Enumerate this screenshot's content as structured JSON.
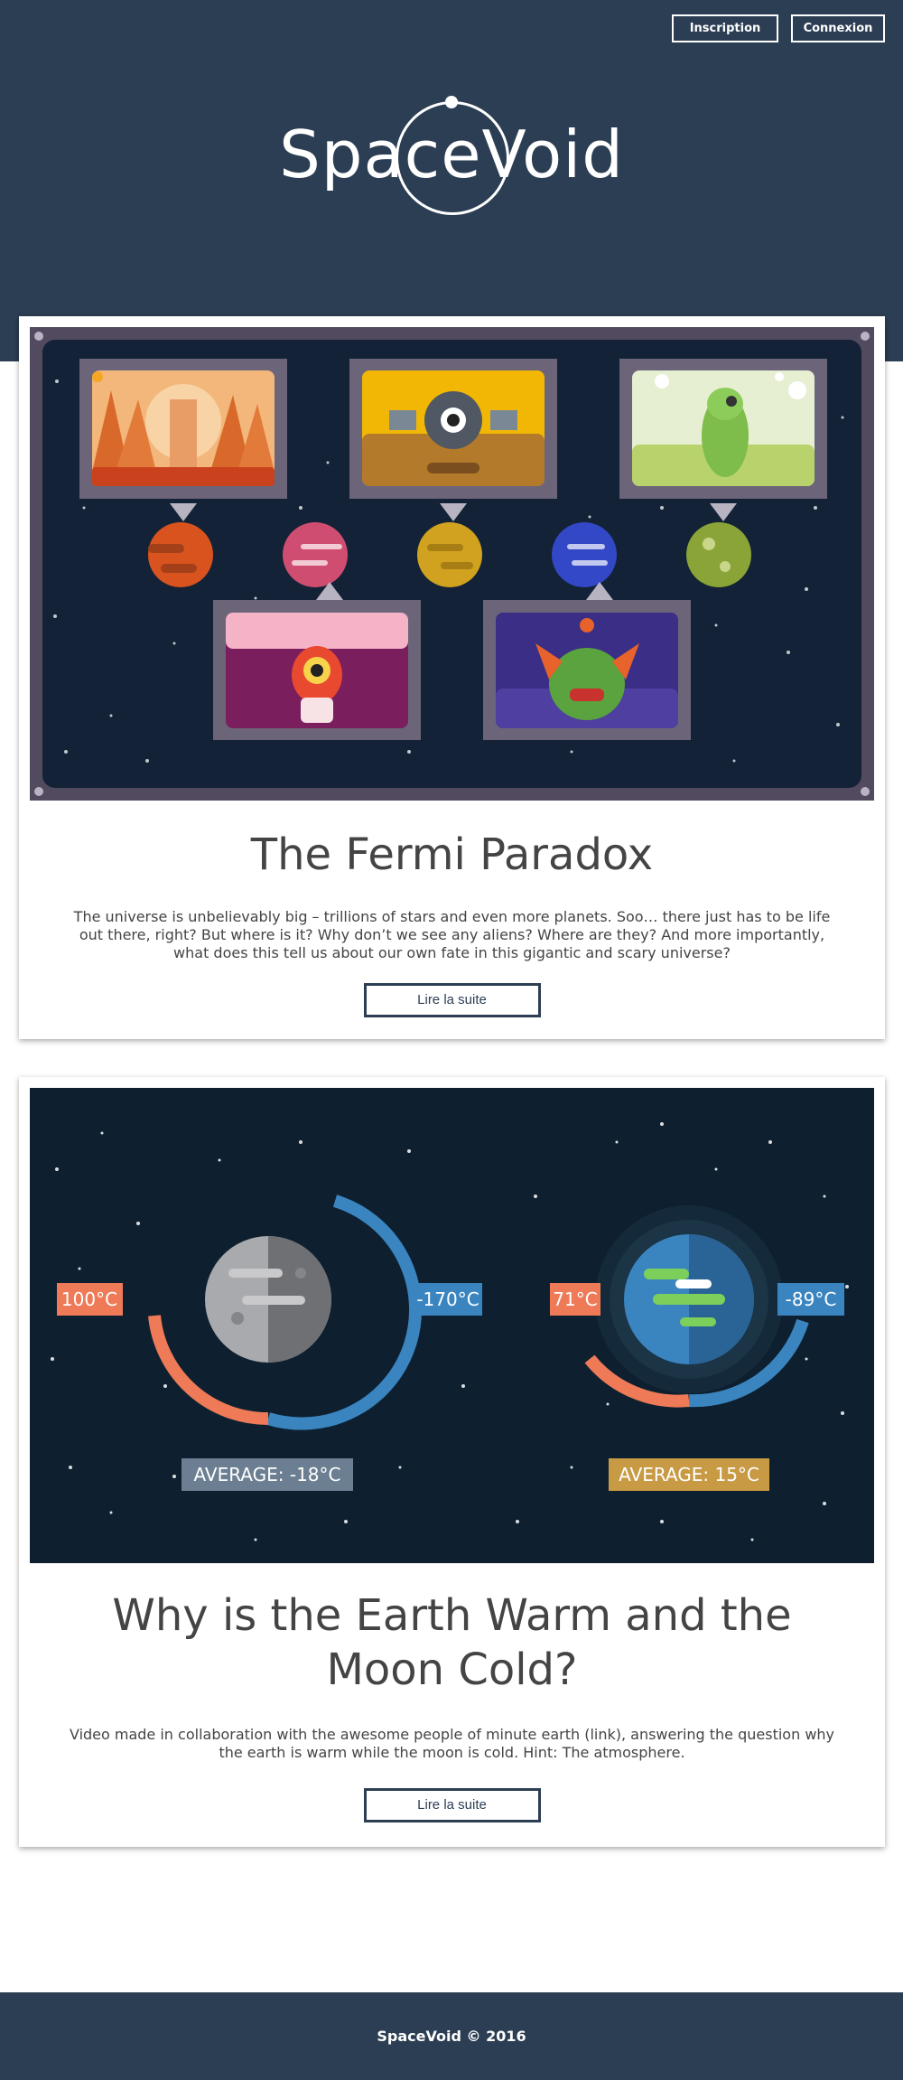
{
  "header": {
    "signup_label": "Inscription",
    "login_label": "Connexion",
    "logo_text": "SpaceVoid"
  },
  "posts": [
    {
      "title": "The Fermi Paradox",
      "excerpt": "The universe is unbelievably big – trillions of stars and even more planets. Soo… there just has to be life out there, right? But where is it? Why don’t we see any aliens? Where are they? And more importantly, what does this tell us about our own fate in this gigantic and scary universe?",
      "button_label": "Lire la suite"
    },
    {
      "title": "Why is the Earth Warm and the Moon Cold?",
      "excerpt": "Video made in collaboration with the awesome people of minute earth (link), answering the question why the earth is warm while the moon is cold. Hint: The atmosphere.",
      "button_label": "Lire la suite",
      "illustration": {
        "moon_hot": "100°C",
        "moon_cold": "-170°C",
        "moon_average": "AVERAGE: -18°C",
        "earth_hot": "71°C",
        "earth_cold": "-89°C",
        "earth_average": "AVERAGE: 15°C"
      }
    }
  ],
  "footer": {
    "copyright": "SpaceVoid © 2016"
  },
  "colors": {
    "brand_navy": "#2c3e53",
    "space_dark": "#0e2030",
    "hot": "#ee7a57",
    "cold": "#3a85c0",
    "moon_average_bg": "#6c7f92",
    "earth_average_bg": "#c89a44"
  }
}
